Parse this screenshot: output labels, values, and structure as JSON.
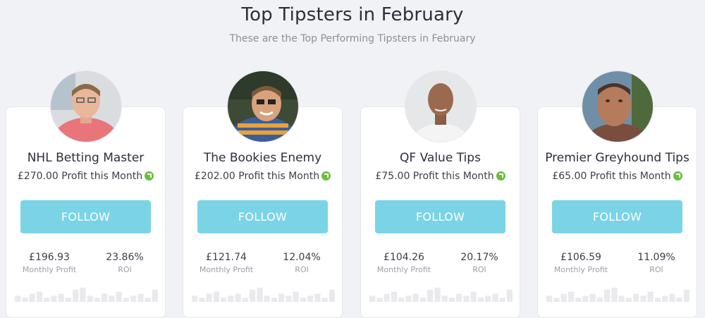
{
  "header": {
    "title": "Top Tipsters in February",
    "subtitle": "These are the Top Performing Tipsters in February"
  },
  "colors": {
    "follow_button": "#7ad4e6",
    "trend_up": "#6abf3a",
    "sparkline_bars": "#e9eaee"
  },
  "tipsters": [
    {
      "name": "NHL Betting Master",
      "profit_text": "£270.00 Profit this Month",
      "follow_label": "FOLLOW",
      "monthly_profit": "£196.93",
      "monthly_profit_label": "Monthly Profit",
      "roi": "23.86%",
      "roi_label": "ROI",
      "sparkline": [
        3,
        2,
        4,
        5,
        2,
        3,
        4,
        2,
        6,
        7,
        3,
        2,
        4,
        3,
        5,
        2,
        3,
        4,
        2,
        6
      ]
    },
    {
      "name": "The Bookies Enemy",
      "profit_text": "£202.00 Profit this Month",
      "follow_label": "FOLLOW",
      "monthly_profit": "£121.74",
      "monthly_profit_label": "Monthly Profit",
      "roi": "12.04%",
      "roi_label": "ROI",
      "sparkline": [
        3,
        2,
        4,
        5,
        2,
        3,
        4,
        2,
        6,
        7,
        3,
        2,
        4,
        3,
        5,
        2,
        3,
        4,
        2,
        6
      ]
    },
    {
      "name": "QF Value Tips",
      "profit_text": "£75.00 Profit this Month",
      "follow_label": "FOLLOW",
      "monthly_profit": "£104.26",
      "monthly_profit_label": "Monthly Profit",
      "roi": "20.17%",
      "roi_label": "ROI",
      "sparkline": [
        3,
        2,
        4,
        5,
        2,
        3,
        4,
        2,
        6,
        7,
        3,
        2,
        4,
        3,
        5,
        2,
        3,
        4,
        2,
        6
      ]
    },
    {
      "name": "Premier Greyhound Tips",
      "profit_text": "£65.00 Profit this Month",
      "follow_label": "FOLLOW",
      "monthly_profit": "£106.59",
      "monthly_profit_label": "Monthly Profit",
      "roi": "11.09%",
      "roi_label": "ROI",
      "sparkline": [
        3,
        2,
        4,
        5,
        2,
        3,
        4,
        2,
        6,
        7,
        3,
        2,
        4,
        3,
        5,
        2,
        3,
        4,
        2,
        6
      ]
    }
  ]
}
